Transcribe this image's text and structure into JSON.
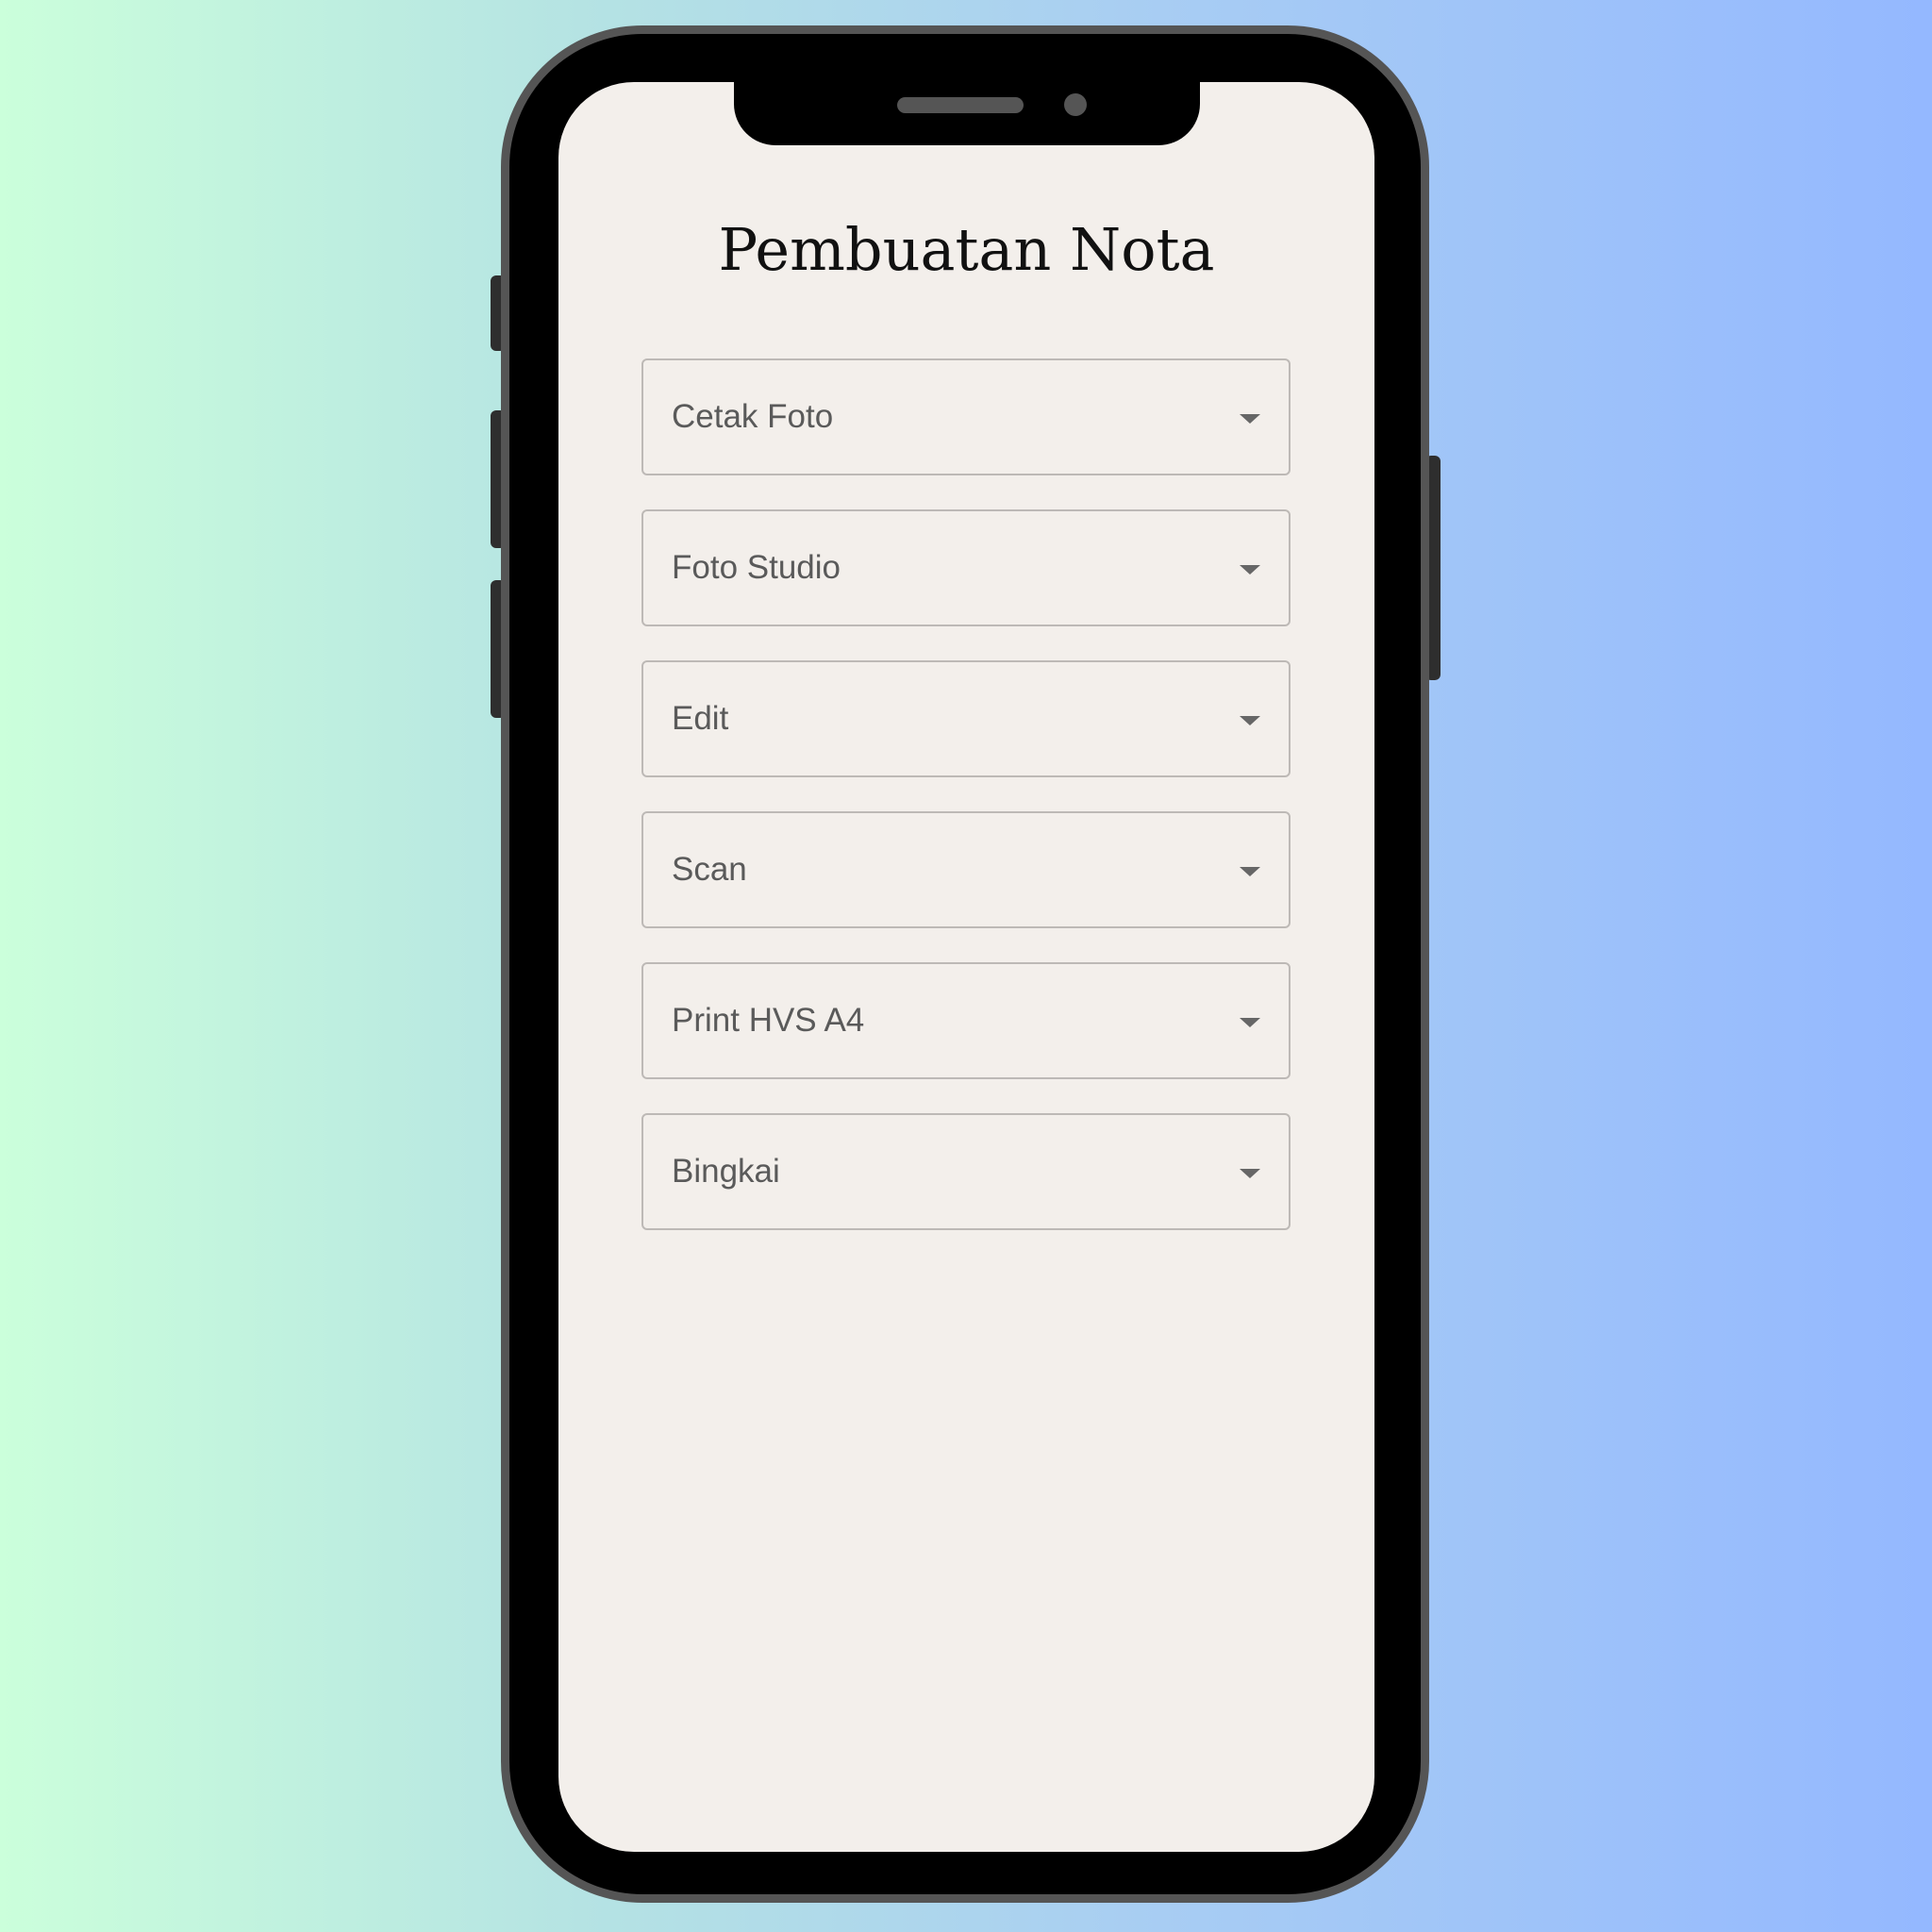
{
  "app": {
    "title": "Pembuatan Nota"
  },
  "selects": [
    {
      "value": "Cetak Foto",
      "icon": "chevron-down-icon"
    },
    {
      "value": "Foto Studio",
      "icon": "chevron-down-icon"
    },
    {
      "value": "Edit",
      "icon": "chevron-down-icon"
    },
    {
      "value": "Scan",
      "icon": "chevron-down-icon"
    },
    {
      "value": "Print HVS A4",
      "icon": "chevron-down-icon"
    },
    {
      "value": "Bingkai",
      "icon": "chevron-down-icon"
    }
  ],
  "colors": {
    "screen_background": "#f3efeb",
    "phone_frame": "#000000",
    "phone_bezel": "#555555",
    "select_border": "#bdb9b6",
    "select_text": "#5a5a5a"
  }
}
